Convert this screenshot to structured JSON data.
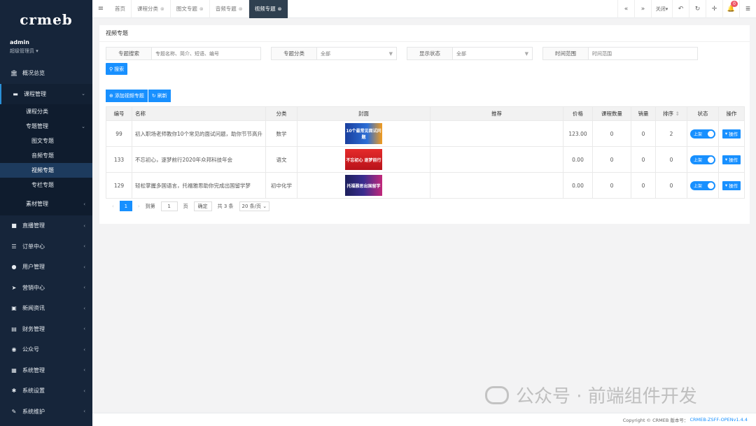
{
  "sidebar": {
    "logo": "crmeb",
    "user": {
      "name": "admin",
      "role": "超级管理员 ▾"
    },
    "overview": {
      "label": "概况总览",
      "icon": "bank-icon"
    },
    "course_mgmt": {
      "label": "课程管理",
      "icon": "book-icon"
    },
    "course_category": "课程分类",
    "topic_mgmt": "专题管理",
    "topic_items": [
      "图文专题",
      "音频专题",
      "视频专题",
      "专栏专题"
    ],
    "material_mgmt": "素材管理",
    "items": [
      {
        "label": "直播管理",
        "icon": "video-icon"
      },
      {
        "label": "订单中心",
        "icon": "list-icon"
      },
      {
        "label": "用户管理",
        "icon": "user-icon"
      },
      {
        "label": "营销中心",
        "icon": "send-icon"
      },
      {
        "label": "新闻资讯",
        "icon": "image-icon"
      },
      {
        "label": "财务管理",
        "icon": "money-icon"
      },
      {
        "label": "公众号",
        "icon": "wechat-icon"
      },
      {
        "label": "系统管理",
        "icon": "grid-icon"
      },
      {
        "label": "系统设置",
        "icon": "gear-icon"
      },
      {
        "label": "系统维护",
        "icon": "wrench-icon"
      }
    ]
  },
  "topbar": {
    "tabs": [
      "首页",
      "课程分类",
      "图文专题",
      "音频专题",
      "视频专题"
    ],
    "close_label": "关闭▾",
    "notification_count": "0"
  },
  "page": {
    "title": "视频专题",
    "filters": {
      "search_label": "专题搜索",
      "search_placeholder": "专题名称、简介、短语、编号",
      "category_label": "专题分类",
      "category_value": "全部",
      "status_label": "显示状态",
      "status_value": "全部",
      "time_label": "时间范围",
      "time_placeholder": "时间范围"
    },
    "search_button": "搜索",
    "add_button": "添加视频专题",
    "refresh_button": "刷新"
  },
  "table": {
    "headers": [
      "编号",
      "名称",
      "分类",
      "封面",
      "推荐",
      "价格",
      "课程数量",
      "销量",
      "排序",
      "状态",
      "操作"
    ],
    "rows": [
      {
        "id": "99",
        "name": "初入职场老师教你10个常见的面试问题，助你节节高升",
        "category": "数学",
        "cover": "10个最常见面试问题",
        "price": "123.00",
        "courses": "0",
        "sales": "0",
        "sort": "2",
        "status": "上架",
        "op": "操作"
      },
      {
        "id": "133",
        "name": "不忘初心，逐梦前行2020年众邦科技年会",
        "category": "语文",
        "cover": "不忘初心 逐梦前行",
        "price": "0.00",
        "courses": "0",
        "sales": "0",
        "sort": "0",
        "status": "上架",
        "op": "操作"
      },
      {
        "id": "129",
        "name": "轻松掌握多国语言，托福雅思助你完成出国留学梦",
        "category": "初中化学",
        "cover": "托福雅思出国留学",
        "price": "0.00",
        "courses": "0",
        "sales": "0",
        "sort": "0",
        "status": "上架",
        "op": "操作"
      }
    ]
  },
  "pager": {
    "current": "1",
    "goto_label": "到第",
    "page_input": "1",
    "page_unit": "页",
    "confirm": "确定",
    "total": "共 3 条",
    "page_size": "20 条/页"
  },
  "watermark": "公众号 · 前端组件开发",
  "footer": {
    "copyright": "Copyright © CRMEB 版本号：",
    "version": "CRMEB-ZSFF-OPENv1.4.4"
  },
  "colors": {
    "accent": "#1890ff",
    "sidebar": "#16253a"
  }
}
